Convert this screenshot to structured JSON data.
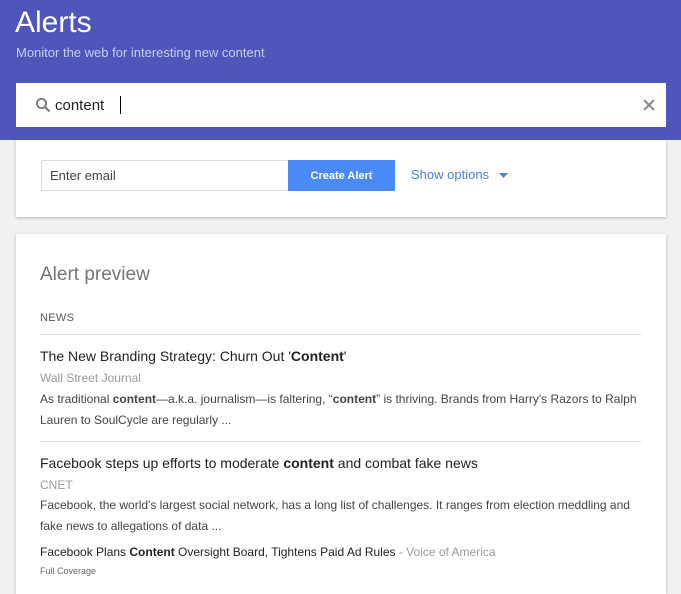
{
  "header": {
    "title": "Alerts",
    "subtitle": "Monitor the web for interesting new content",
    "background": "#4e57b9"
  },
  "search": {
    "value": "content",
    "icon": "search-icon",
    "clear_icon": "close-icon"
  },
  "create_form": {
    "email_placeholder": "Enter email",
    "create_button_label": "Create Alert",
    "show_options_label": "Show options",
    "accent": "#4a8af4"
  },
  "preview": {
    "title": "Alert preview",
    "section_label": "NEWS",
    "items": [
      {
        "title": [
          "The New Branding Strategy: Churn Out '",
          "Content",
          "'"
        ],
        "source": "Wall Street Journal",
        "snippet_line1": [
          "As traditional ",
          "content",
          "—a.k.a. journalism—is faltering, “",
          "content",
          "” is thriving. Brands from Harry's Razors to Ralph"
        ],
        "snippet_line2": "Lauren to SoulCycle are regularly ..."
      },
      {
        "title": [
          "Facebook steps up efforts to moderate ",
          "content",
          " and combat fake news"
        ],
        "source": "CNET",
        "snippet_line1": "Facebook, the world's largest social network, has a long list of challenges. It ranges from election meddling and",
        "snippet_line2": "fake news to allegations of data ...",
        "related": {
          "title": [
            "Facebook Plans ",
            "Content",
            " Oversight Board, Tightens Paid Ad Rules"
          ],
          "source": " - Voice of America"
        },
        "full_coverage": "Full Coverage"
      }
    ]
  }
}
